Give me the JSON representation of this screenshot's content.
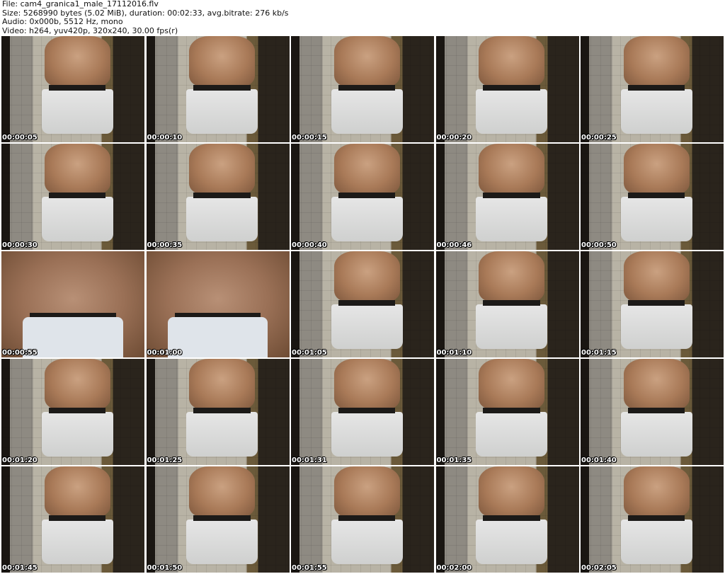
{
  "header": {
    "file": "File: cam4_granica1_male_17112016.flv",
    "size": "Size: 5268990 bytes (5.02 MiB), duration: 00:02:33, avg.bitrate: 276 kb/s",
    "audio": "Audio: 0x000b, 5512 Hz, mono",
    "video": "Video: h264, yuv420p, 320x240, 30.00 fps(r)"
  },
  "thumbnails": [
    {
      "time": "00:00:05",
      "kind": "full"
    },
    {
      "time": "00:00:10",
      "kind": "full"
    },
    {
      "time": "00:00:15",
      "kind": "full"
    },
    {
      "time": "00:00:20",
      "kind": "full"
    },
    {
      "time": "00:00:25",
      "kind": "full"
    },
    {
      "time": "00:00:30",
      "kind": "full"
    },
    {
      "time": "00:00:35",
      "kind": "full"
    },
    {
      "time": "00:00:40",
      "kind": "full"
    },
    {
      "time": "00:00:46",
      "kind": "full"
    },
    {
      "time": "00:00:50",
      "kind": "full"
    },
    {
      "time": "00:00:55",
      "kind": "closeup"
    },
    {
      "time": "00:01:00",
      "kind": "closeup"
    },
    {
      "time": "00:01:05",
      "kind": "full"
    },
    {
      "time": "00:01:10",
      "kind": "full"
    },
    {
      "time": "00:01:15",
      "kind": "full"
    },
    {
      "time": "00:01:20",
      "kind": "full"
    },
    {
      "time": "00:01:25",
      "kind": "full"
    },
    {
      "time": "00:01:31",
      "kind": "full"
    },
    {
      "time": "00:01:35",
      "kind": "full"
    },
    {
      "time": "00:01:40",
      "kind": "full"
    },
    {
      "time": "00:01:45",
      "kind": "full"
    },
    {
      "time": "00:01:50",
      "kind": "full"
    },
    {
      "time": "00:01:55",
      "kind": "full"
    },
    {
      "time": "00:02:00",
      "kind": "full"
    },
    {
      "time": "00:02:05",
      "kind": "full"
    }
  ]
}
